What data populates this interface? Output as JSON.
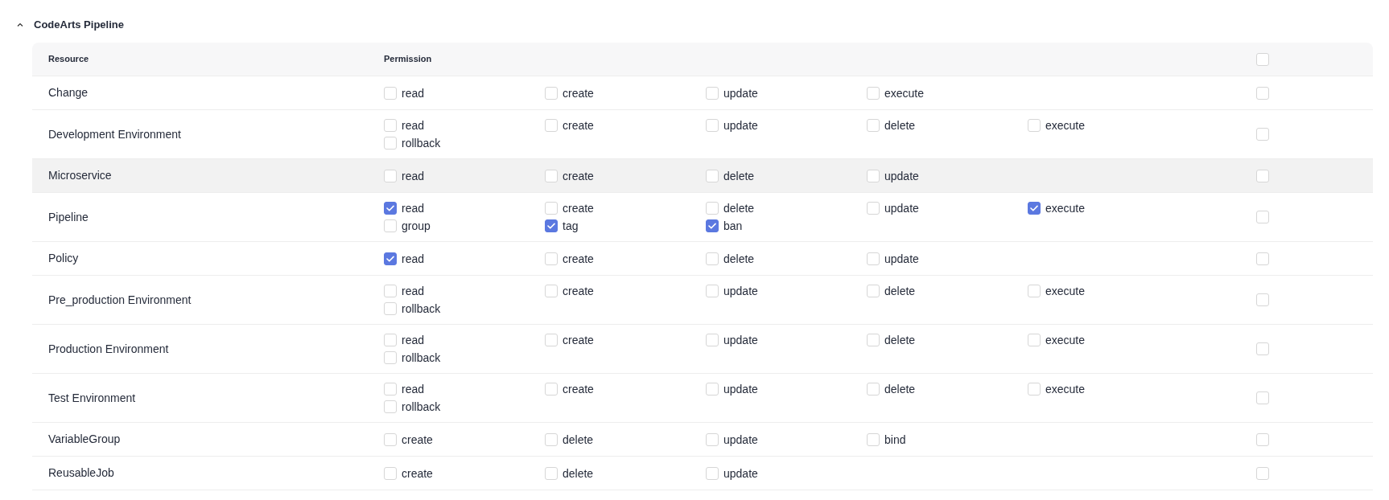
{
  "section": {
    "title": "CodeArts Pipeline",
    "expanded": true
  },
  "table": {
    "columns": [
      "Resource",
      "Permission"
    ],
    "header_checked": false,
    "rows": [
      {
        "resource": "Change",
        "highlighted": false,
        "checked": false,
        "permissions": [
          {
            "label": "read",
            "checked": false
          },
          {
            "label": "create",
            "checked": false
          },
          {
            "label": "update",
            "checked": false
          },
          {
            "label": "execute",
            "checked": false
          }
        ]
      },
      {
        "resource": "Development Environment",
        "highlighted": false,
        "checked": false,
        "permissions": [
          {
            "label": "read",
            "checked": false
          },
          {
            "label": "create",
            "checked": false
          },
          {
            "label": "update",
            "checked": false
          },
          {
            "label": "delete",
            "checked": false
          },
          {
            "label": "execute",
            "checked": false
          },
          {
            "label": "rollback",
            "checked": false
          }
        ]
      },
      {
        "resource": "Microservice",
        "highlighted": true,
        "checked": false,
        "permissions": [
          {
            "label": "read",
            "checked": false
          },
          {
            "label": "create",
            "checked": false
          },
          {
            "label": "delete",
            "checked": false
          },
          {
            "label": "update",
            "checked": false
          }
        ]
      },
      {
        "resource": "Pipeline",
        "highlighted": false,
        "checked": false,
        "permissions": [
          {
            "label": "read",
            "checked": true
          },
          {
            "label": "create",
            "checked": false
          },
          {
            "label": "delete",
            "checked": false
          },
          {
            "label": "update",
            "checked": false
          },
          {
            "label": "execute",
            "checked": true
          },
          {
            "label": "group",
            "checked": false
          },
          {
            "label": "tag",
            "checked": true
          },
          {
            "label": "ban",
            "checked": true
          }
        ]
      },
      {
        "resource": "Policy",
        "highlighted": false,
        "checked": false,
        "permissions": [
          {
            "label": "read",
            "checked": true
          },
          {
            "label": "create",
            "checked": false
          },
          {
            "label": "delete",
            "checked": false
          },
          {
            "label": "update",
            "checked": false
          }
        ]
      },
      {
        "resource": "Pre_production Environment",
        "highlighted": false,
        "checked": false,
        "permissions": [
          {
            "label": "read",
            "checked": false
          },
          {
            "label": "create",
            "checked": false
          },
          {
            "label": "update",
            "checked": false
          },
          {
            "label": "delete",
            "checked": false
          },
          {
            "label": "execute",
            "checked": false
          },
          {
            "label": "rollback",
            "checked": false
          }
        ]
      },
      {
        "resource": "Production Environment",
        "highlighted": false,
        "checked": false,
        "permissions": [
          {
            "label": "read",
            "checked": false
          },
          {
            "label": "create",
            "checked": false
          },
          {
            "label": "update",
            "checked": false
          },
          {
            "label": "delete",
            "checked": false
          },
          {
            "label": "execute",
            "checked": false
          },
          {
            "label": "rollback",
            "checked": false
          }
        ]
      },
      {
        "resource": "Test Environment",
        "highlighted": false,
        "checked": false,
        "permissions": [
          {
            "label": "read",
            "checked": false
          },
          {
            "label": "create",
            "checked": false
          },
          {
            "label": "update",
            "checked": false
          },
          {
            "label": "delete",
            "checked": false
          },
          {
            "label": "execute",
            "checked": false
          },
          {
            "label": "rollback",
            "checked": false
          }
        ]
      },
      {
        "resource": "VariableGroup",
        "highlighted": false,
        "checked": false,
        "permissions": [
          {
            "label": "create",
            "checked": false
          },
          {
            "label": "delete",
            "checked": false
          },
          {
            "label": "update",
            "checked": false
          },
          {
            "label": "bind",
            "checked": false
          }
        ]
      },
      {
        "resource": "ReusableJob",
        "highlighted": false,
        "checked": false,
        "permissions": [
          {
            "label": "create",
            "checked": false
          },
          {
            "label": "delete",
            "checked": false
          },
          {
            "label": "update",
            "checked": false
          }
        ]
      }
    ]
  }
}
